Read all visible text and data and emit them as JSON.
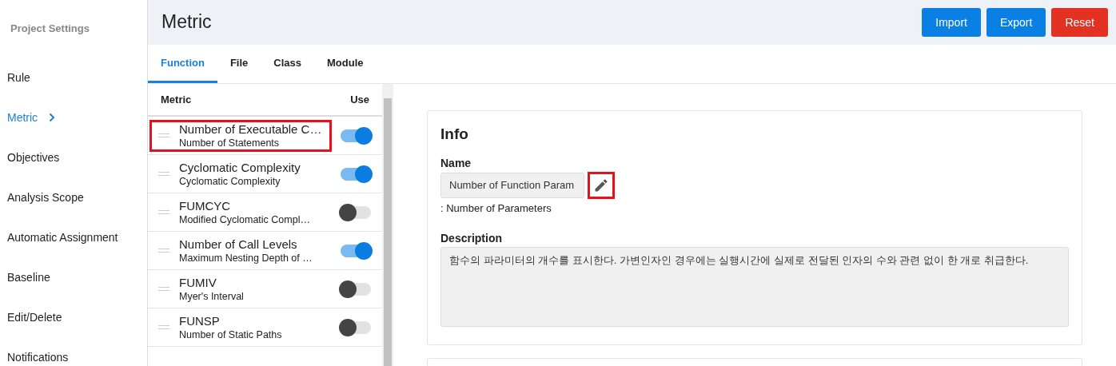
{
  "sidebar": {
    "title": "Project Settings",
    "items": [
      {
        "label": "Rule",
        "selected": false
      },
      {
        "label": "Metric",
        "selected": true
      },
      {
        "label": "Objectives",
        "selected": false
      },
      {
        "label": "Analysis Scope",
        "selected": false
      },
      {
        "label": "Automatic Assignment",
        "selected": false
      },
      {
        "label": "Baseline",
        "selected": false
      },
      {
        "label": "Edit/Delete",
        "selected": false
      },
      {
        "label": "Notifications",
        "selected": false
      }
    ]
  },
  "header": {
    "title": "Metric",
    "buttons": [
      {
        "label": "Import",
        "kind": "primary"
      },
      {
        "label": "Export",
        "kind": "primary"
      },
      {
        "label": "Reset",
        "kind": "danger"
      }
    ]
  },
  "tabs": [
    {
      "label": "Function",
      "selected": true
    },
    {
      "label": "File",
      "selected": false
    },
    {
      "label": "Class",
      "selected": false
    },
    {
      "label": "Module",
      "selected": false
    }
  ],
  "metric_list": {
    "columns": [
      "Metric",
      "Use"
    ],
    "rows": [
      {
        "name": "Number of Executable C…",
        "subtitle": "Number of Statements",
        "on": true,
        "highlighted": true
      },
      {
        "name": "Cyclomatic Complexity",
        "subtitle": "Cyclomatic Complexity",
        "on": true,
        "highlighted": false
      },
      {
        "name": "FUMCYC",
        "subtitle": "Modified Cyclomatic Compl…",
        "on": false,
        "highlighted": false
      },
      {
        "name": "Number of Call Levels",
        "subtitle": "Maximum Nesting Depth of …",
        "on": true,
        "highlighted": false
      },
      {
        "name": "FUMIV",
        "subtitle": "Myer's Interval",
        "on": false,
        "highlighted": false
      },
      {
        "name": "FUNSP",
        "subtitle": "Number of Static Paths",
        "on": false,
        "highlighted": false
      }
    ]
  },
  "info": {
    "title": "Info",
    "name_label": "Name",
    "name_value": "Number of Function Param",
    "edit_highlighted": true,
    "name_note": ": Number of Parameters",
    "description_label": "Description",
    "description": "함수의 파라미터의 개수를 표시한다. 가변인자인 경우에는 실행시간에 실제로 전달된 인자의 수와 관련 없이 한 개로 취급한다."
  }
}
